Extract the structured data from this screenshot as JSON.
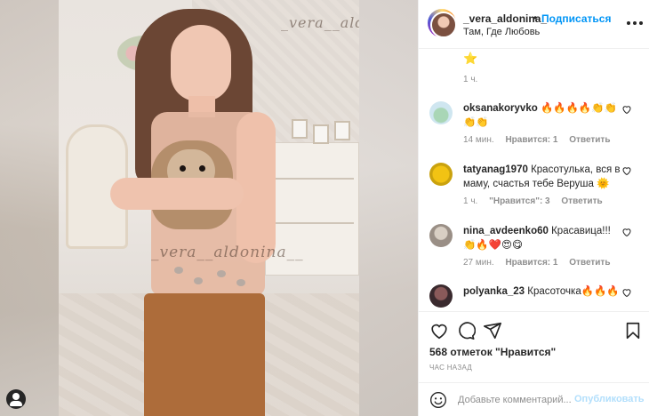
{
  "photo": {
    "watermark_top": "_vera__aldonina__",
    "watermark_mid": "_vera__aldonina__"
  },
  "header": {
    "username": "_vera_aldonina_",
    "separator": "•",
    "follow_label": "Подписаться",
    "location": "Там, Где Любовь"
  },
  "comments": [
    {
      "username": "",
      "text": "⭐",
      "time": "1 ч.",
      "likes": "",
      "reply": ""
    },
    {
      "username": "oksanakoryvko",
      "text": "🔥🔥🔥🔥👏👏👏👏",
      "time": "14 мин.",
      "likes": "Нравится: 1",
      "reply": "Ответить"
    },
    {
      "username": "tatyanag1970",
      "text": "Красотулька, вся в маму, счастья тебе Веруша 🌞",
      "time": "1 ч.",
      "likes": "\"Нравится\": 3",
      "reply": "Ответить"
    },
    {
      "username": "nina_avdeenko60",
      "text": "Красавица!!! 👏🔥❤️😍😋",
      "time": "27 мин.",
      "likes": "Нравится: 1",
      "reply": "Ответить"
    },
    {
      "username": "polyanka_23",
      "text": "Красоточка🔥🔥🔥",
      "time": "",
      "likes": "",
      "reply": ""
    }
  ],
  "actions": {
    "icons": [
      "heart-icon",
      "comment-icon",
      "share-icon",
      "bookmark-icon"
    ],
    "likes": "568 отметок \"Нравится\"",
    "time_ago": "ЧАС НАЗАД"
  },
  "comment_bar": {
    "placeholder": "Добавьте комментарий...",
    "publish_label": "Опубликовать"
  },
  "colors": {
    "link_blue": "#0095f6",
    "publish_disabled": "#b2dffc",
    "meta_gray": "#8e8e8e"
  }
}
